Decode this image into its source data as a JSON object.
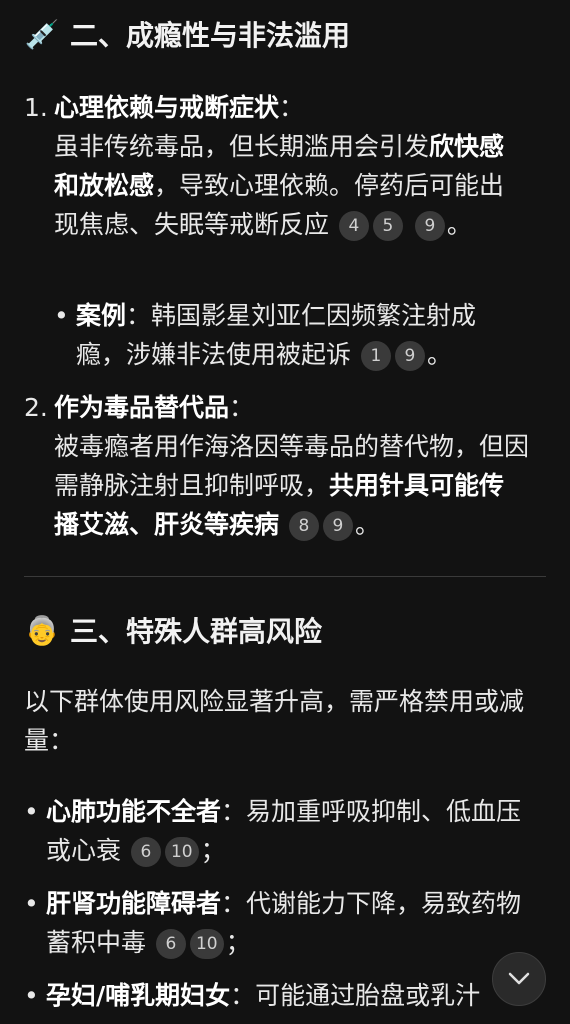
{
  "section2": {
    "emoji": "💉",
    "title": "二、成瘾性与非法滥用",
    "item1": {
      "num": "1.",
      "label": "心理依赖与戒断症状",
      "colon": "：",
      "text_a": "虽非传统毒品，但长期滥用会引发",
      "bold_a": "欣快感和放松感",
      "text_b": "，导致心理依赖。停药后可能出现焦虑、失眠等戒断反应",
      "badges": [
        "4",
        "5",
        "9"
      ],
      "end": "。",
      "case": {
        "label": "案例",
        "colon": "：",
        "text": "韩国影星刘亚仁因频繁注射成瘾，涉嫌非法使用被起诉",
        "badges": [
          "1",
          "9"
        ],
        "end": "。"
      }
    },
    "item2": {
      "num": "2.",
      "label": "作为毒品替代品",
      "colon": "：",
      "text_a": "被毒瘾者用作海洛因等毒品的替代物，但因需静脉注射且抑制呼吸，",
      "bold_a": "共用针具可能传播艾滋、肝炎等疾病",
      "badges": [
        "8",
        "9"
      ],
      "end": "。"
    }
  },
  "section3": {
    "emoji": "👵",
    "title": "三、特殊人群高风险",
    "intro": "以下群体使用风险显著升高，需严格禁用或减量：",
    "bullets": [
      {
        "label": "心肺功能不全者",
        "colon": "：",
        "text": "易加重呼吸抑制、低血压或心衰",
        "badges": [
          "6",
          "10"
        ],
        "end": "；"
      },
      {
        "label": "肝肾功能障碍者",
        "colon": "：",
        "text": "代谢能力下降，易致药物蓄积中毒",
        "badges": [
          "6",
          "10"
        ],
        "end": "；"
      },
      {
        "label": "孕妇/哺乳期妇女",
        "colon": "：",
        "text": "可能通过胎盘或乳汁"
      }
    ]
  },
  "ui": {
    "scroll_icon": "chevron-down-icon"
  }
}
